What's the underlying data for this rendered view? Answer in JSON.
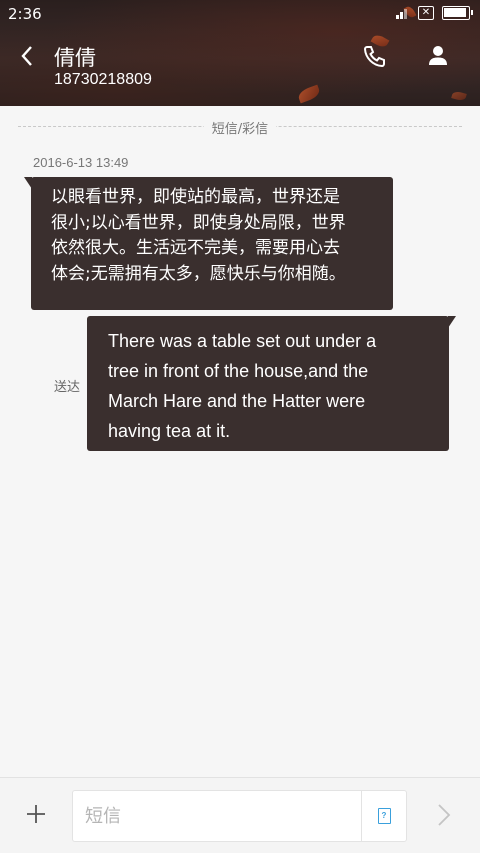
{
  "status_bar": {
    "time": "2:36",
    "sim_status": "✕",
    "battery_level": 0.9,
    "icons": [
      "signal-icon",
      "sim-x-icon",
      "battery-icon"
    ]
  },
  "header": {
    "contact_name": "倩倩",
    "contact_number": "18730218809",
    "icons": [
      "back-arrow-icon",
      "phone-icon",
      "person-icon"
    ]
  },
  "conversation": {
    "message_type_label": "短信/彩信",
    "timestamp": "2016-6-13 13:49",
    "messages": [
      {
        "direction": "incoming",
        "lines": [
          "以眼看世界，即使站的最高，世界还是",
          "很小;以心看世界，即使身处局限，世界",
          "依然很大。生活远不完美，需要用心去",
          "体会;无需拥有太多，愿快乐与你相随。"
        ]
      },
      {
        "direction": "outgoing",
        "lines": [
          "There was a table set out under a",
          "tree in front of the house,and the",
          "March Hare and the Hatter were",
          "having tea at it."
        ],
        "status": "送达"
      }
    ]
  },
  "compose": {
    "placeholder": "短信",
    "value": "",
    "sim_label": "?",
    "icons": [
      "plus-icon",
      "sim-card-icon",
      "send-arrow-icon"
    ]
  },
  "colors": {
    "bubble": "#3a2f2e",
    "background": "#f6f6f6",
    "accent": "#3aa0dc"
  }
}
